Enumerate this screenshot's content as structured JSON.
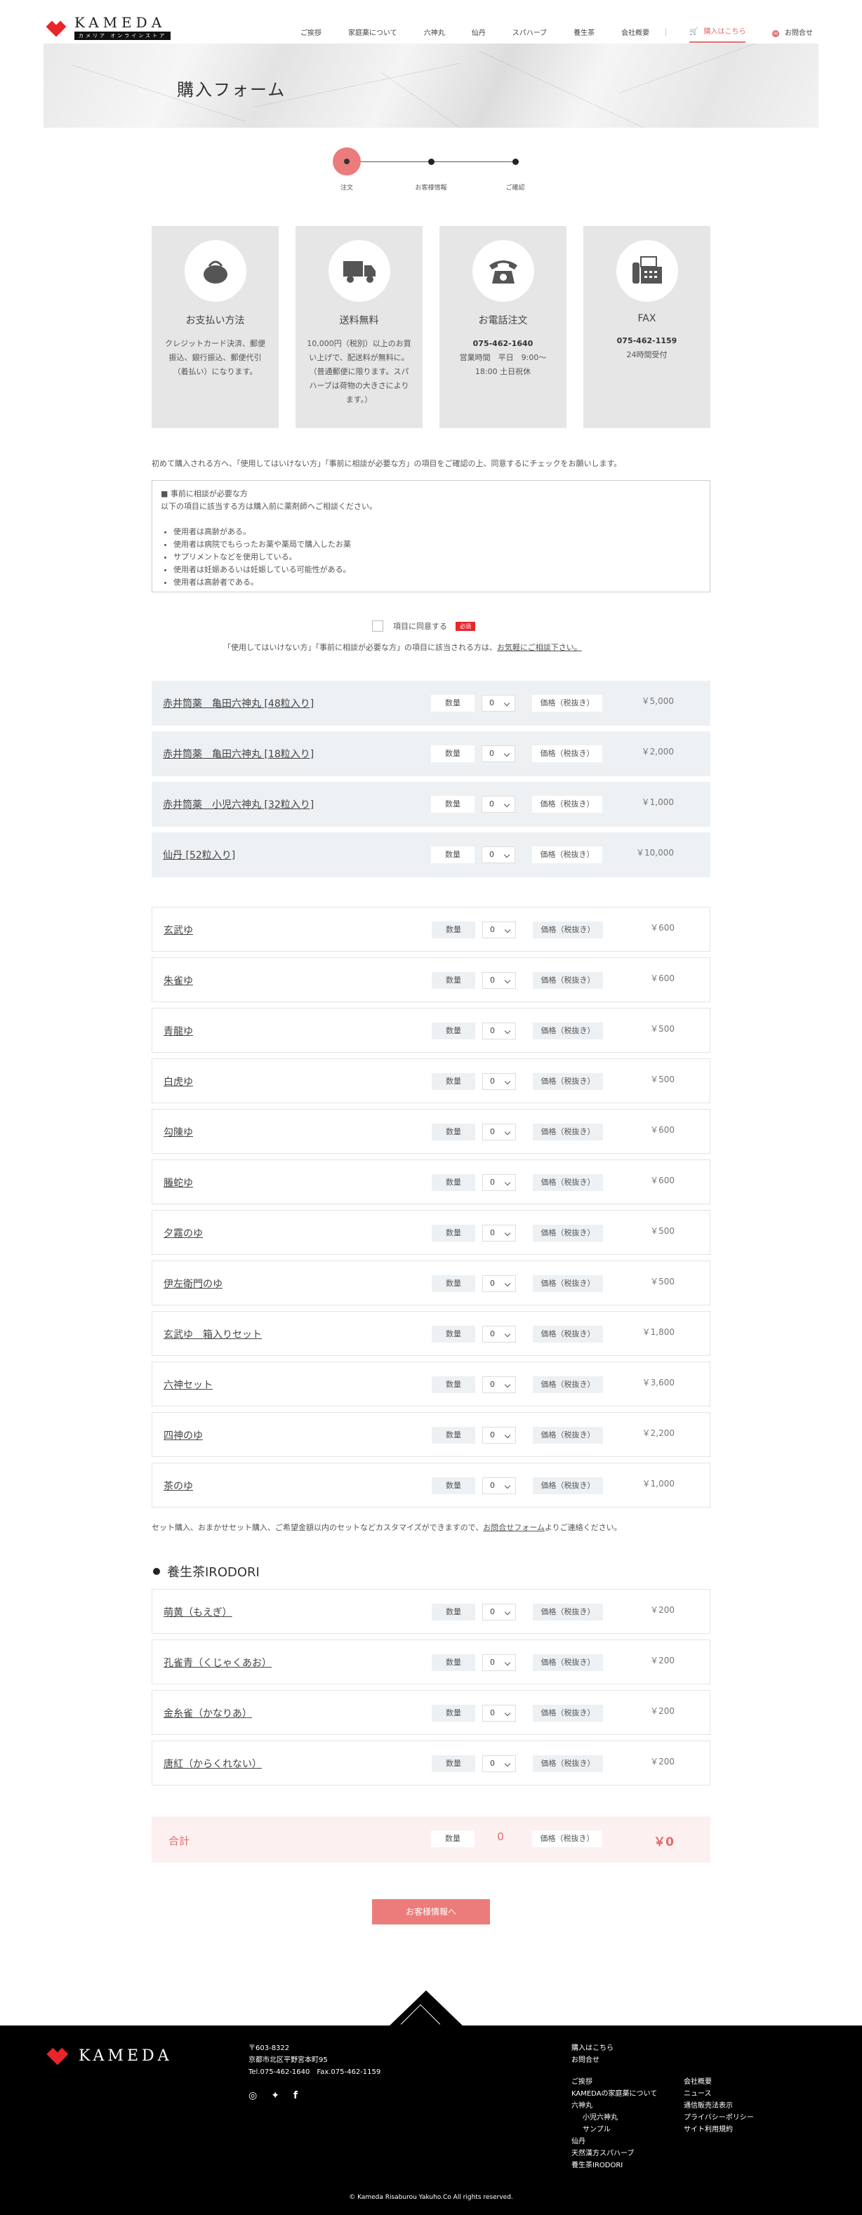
{
  "header": {
    "logo_word": "KAMEDA",
    "logo_sub": "カメリア オンラインストア",
    "nav": [
      "ご挨拶",
      "家庭薬について",
      "六神丸",
      "仙丹",
      "スパハーブ",
      "養生茶",
      "会社概要"
    ],
    "buy_label": "購入はこちら",
    "contact_label": "お問合せ"
  },
  "hero": {
    "title": "購入フォーム"
  },
  "steps": [
    "注文",
    "お客様情報",
    "ご確認"
  ],
  "cards": [
    {
      "title": "お支払い方法",
      "body": "クレジットカード決済、郵便振込、銀行振込、郵便代引（着払い）になります。",
      "strong": "",
      "extra": ""
    },
    {
      "title": "送料無料",
      "body": "10,000円（税別）以上のお買い上げで、配送料が無料に。（普通郵便に限ります。スパハーブは荷物の大きさによります。）",
      "strong": "",
      "extra": ""
    },
    {
      "title": "お電話注文",
      "body": "",
      "strong": "075-462-1640",
      "extra": "営業時間　平日　9:00〜18:00 土日祝休"
    },
    {
      "title": "FAX",
      "body": "",
      "strong": "075-462-1159",
      "extra": "24時間受付"
    }
  ],
  "intro": "初めて購入される方へ、「使用してはいけない方」「事前に相談が必要な方」の項目をご確認の上、同意するにチェックをお願いします。",
  "notice": {
    "heading": "■ 事前に相談が必要な方",
    "lead": "以下の項目に該当する方は購入前に薬剤師へご相談ください。",
    "items": [
      "使用者は高齢がある。",
      "使用者は病院でもらったお薬や薬局で購入したお薬",
      "サプリメントなどを使用している。",
      "使用者は妊娠あるいは妊娠している可能性がある。",
      "使用者は高齢者である。"
    ]
  },
  "agree": {
    "label": "項目に同意する",
    "required": "必須",
    "note_prefix": "「使用してはいけない方」「事前に相談が必要な方」の項目に該当される方は、",
    "note_link": "お気軽にご相談下さい。"
  },
  "labels": {
    "qty": "数量",
    "price": "価格（税抜き）",
    "qty_default": "0"
  },
  "products_main": [
    {
      "name": "赤井筒薬　亀田六神丸 [48粒入り]",
      "price": "￥5,000"
    },
    {
      "name": "赤井筒薬　亀田六神丸 [18粒入り]",
      "price": "￥2,000"
    },
    {
      "name": "赤井筒薬　小児六神丸 [32粒入り]",
      "price": "￥1,000"
    },
    {
      "name": "仙丹 [52粒入り]",
      "price": "￥10,000"
    }
  ],
  "products_herb": [
    {
      "name": "玄武ゆ",
      "price": "￥600"
    },
    {
      "name": "朱雀ゆ",
      "price": "￥600"
    },
    {
      "name": "青龍ゆ",
      "price": "￥500"
    },
    {
      "name": "白虎ゆ",
      "price": "￥500"
    },
    {
      "name": "勾陳ゆ",
      "price": "￥600"
    },
    {
      "name": "螣蛇ゆ",
      "price": "￥600"
    },
    {
      "name": "夕霧のゆ",
      "price": "￥500"
    },
    {
      "name": "伊左衛門のゆ",
      "price": "￥500"
    },
    {
      "name": "玄武ゆ　箱入りセット",
      "price": "￥1,800"
    },
    {
      "name": "六神セット",
      "price": "￥3,600"
    },
    {
      "name": "四神のゆ",
      "price": "￥2,200"
    },
    {
      "name": "茶のゆ",
      "price": "￥1,000"
    }
  ],
  "set_note": {
    "prefix": "セット購入、おまかせセット購入、ご希望金額以内のセットなどカスタマイズができますので、",
    "link": "お問合せフォーム",
    "suffix": "よりご連絡ください。"
  },
  "tea_section": "養生茶IRODORI",
  "products_tea": [
    {
      "name": "萌黄（もえぎ）",
      "price": "￥200"
    },
    {
      "name": "孔雀青（くじゃくあお）",
      "price": "￥200"
    },
    {
      "name": "金糸雀（かなりあ）",
      "price": "￥200"
    },
    {
      "name": "唐紅（からくれない）",
      "price": "￥200"
    }
  ],
  "total": {
    "label": "合計",
    "qty": "0",
    "price": "￥0"
  },
  "submit": "お客様情報へ",
  "footer": {
    "logo_word": "KAMEDA",
    "addr": [
      "〒603-8322",
      "京都市北区平野宮本町95",
      "Tel.075-462-1640　Fax.075-462-1159"
    ],
    "links_top": [
      "購入はこちら",
      "お問合せ"
    ],
    "links_left": [
      "ご挨拶",
      "KAMEDAの家庭薬について",
      "六神丸",
      "小児六神丸",
      "サンプル",
      "仙丹",
      "天然漢方スパハーブ",
      "養生茶IRODORI"
    ],
    "links_right": [
      "会社概要",
      "ニュース",
      "通信販売法表示",
      "プライバシーポリシー",
      "サイト利用規約"
    ],
    "copyright": "© Kameda Risaburou Yakuho.Co All rights reserved."
  },
  "colors": {
    "accent": "#ec7b7b",
    "required": "#e8252b",
    "footer": "#000000"
  }
}
